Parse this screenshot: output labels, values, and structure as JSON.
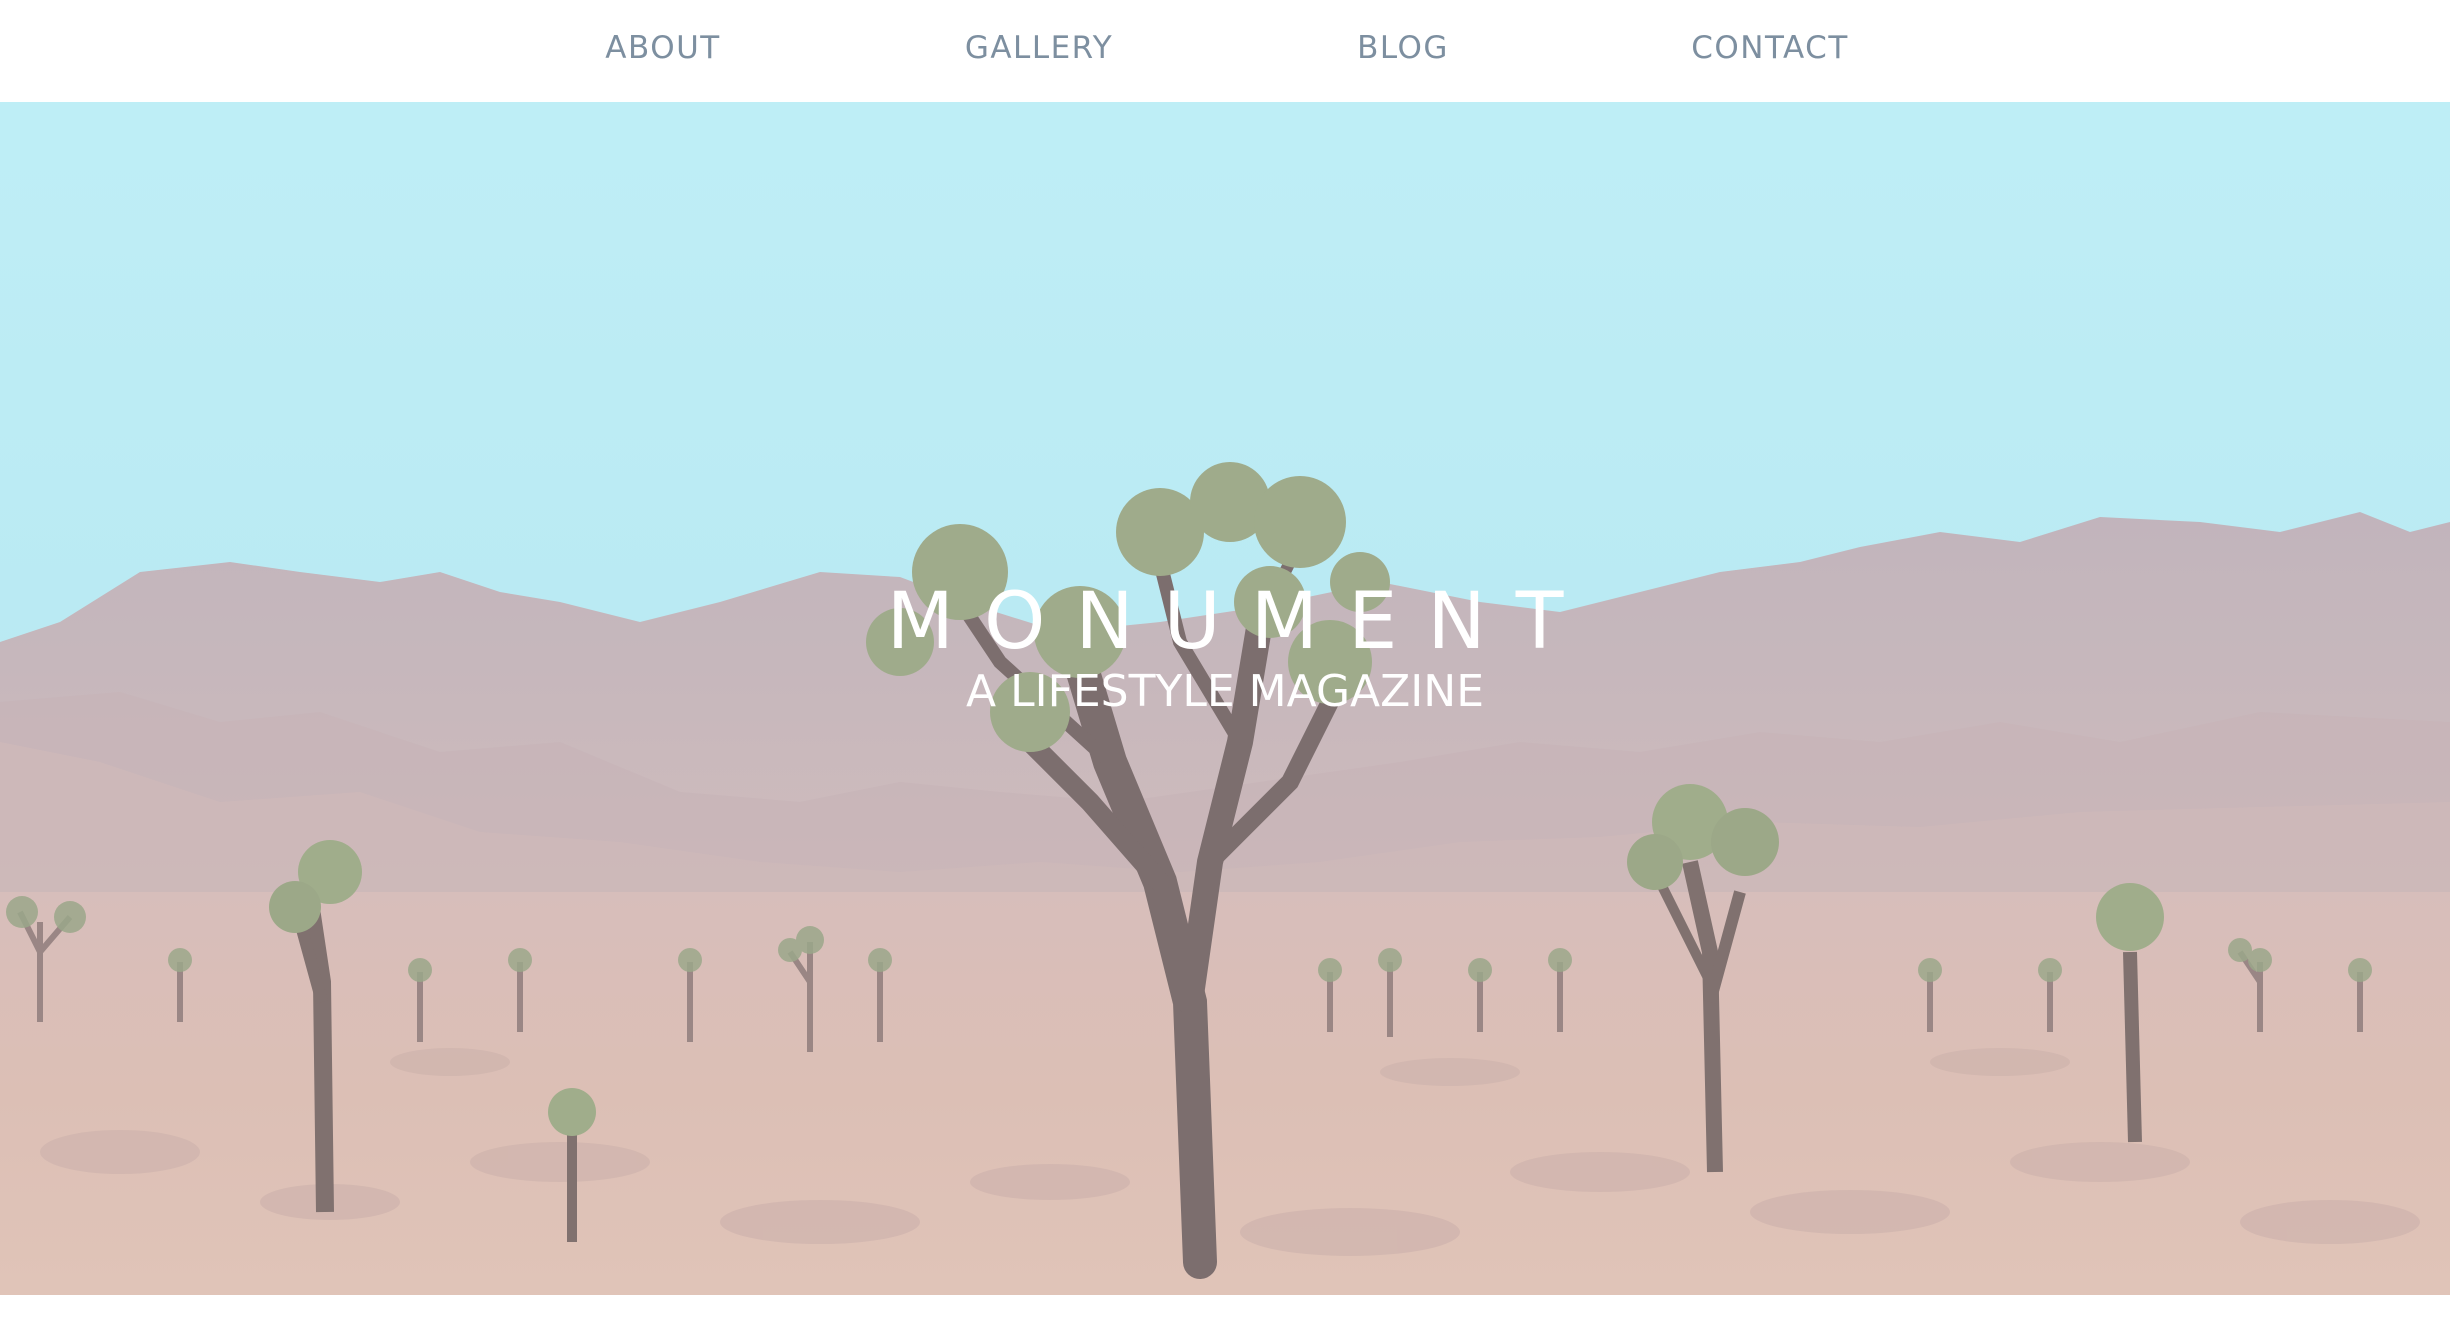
{
  "nav": {
    "items": [
      {
        "label": "ABOUT"
      },
      {
        "label": "GALLERY"
      },
      {
        "label": "BLOG"
      },
      {
        "label": "CONTACT"
      }
    ]
  },
  "hero": {
    "title": "MONUMENT",
    "subtitle": "A LIFESTYLE MAGAZINE",
    "image": "desert-joshua-tree-landscape"
  },
  "colors": {
    "nav_text": "#7d8fa0",
    "sky": "#b4eaf2",
    "ground": "#d9b8ad",
    "mountains": "#c7b0b4",
    "tree": "#6f5e5c",
    "foliage": "#9aa882"
  }
}
